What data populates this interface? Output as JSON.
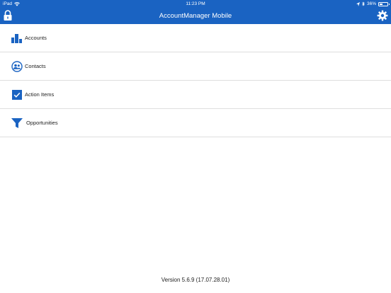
{
  "status": {
    "device": "iPad",
    "time": "11:23 PM",
    "battery": "36%",
    "battery_level": 0.36
  },
  "header": {
    "title": "AccountManager Mobile"
  },
  "menu": {
    "items": [
      {
        "label": "Accounts",
        "icon": "bar-chart-icon"
      },
      {
        "label": "Contacts",
        "icon": "contacts-icon"
      },
      {
        "label": "Action Items",
        "icon": "checkbox-icon"
      },
      {
        "label": "Opportunities",
        "icon": "funnel-icon"
      }
    ]
  },
  "footer": {
    "version": "Version 5.6.9 (17.07.28.01)"
  },
  "colors": {
    "accent": "#1a63c2",
    "background": "#ffffff",
    "divider": "#dedede"
  }
}
